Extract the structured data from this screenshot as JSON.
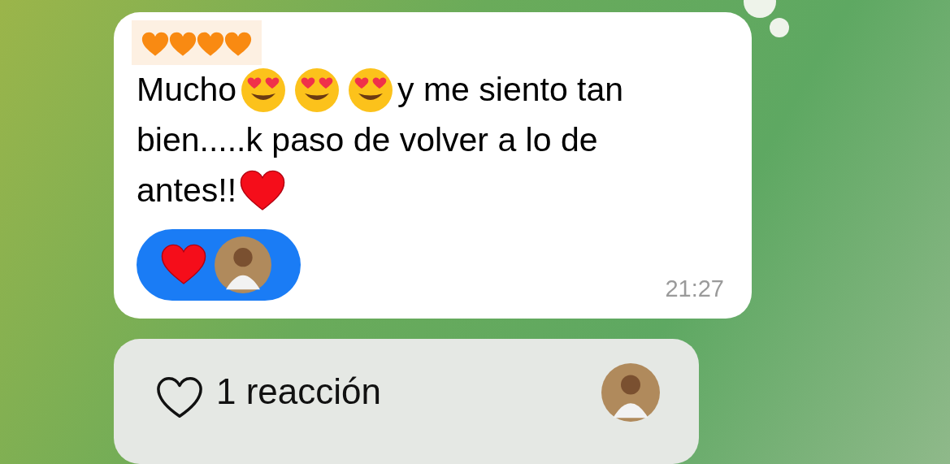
{
  "message": {
    "reply_emojis": [
      {
        "kind": "orange-heart"
      },
      {
        "kind": "orange-heart"
      },
      {
        "kind": "orange-heart"
      },
      {
        "kind": "orange-heart"
      }
    ],
    "lines": [
      [
        {
          "kind": "text",
          "text": "Mucho"
        },
        {
          "kind": "heart-eyes"
        },
        {
          "kind": "heart-eyes"
        },
        {
          "kind": "heart-eyes"
        },
        {
          "kind": "text",
          "text": "y me siento tan"
        }
      ],
      [
        {
          "kind": "text",
          "text": "bien.....k paso de volver a lo de"
        }
      ],
      [
        {
          "kind": "text",
          "text": "antes!!"
        },
        {
          "kind": "red-heart"
        }
      ]
    ],
    "reaction": {
      "selected": true
    },
    "time": "21:27"
  },
  "reactions_panel": {
    "label": "1 reacción"
  }
}
